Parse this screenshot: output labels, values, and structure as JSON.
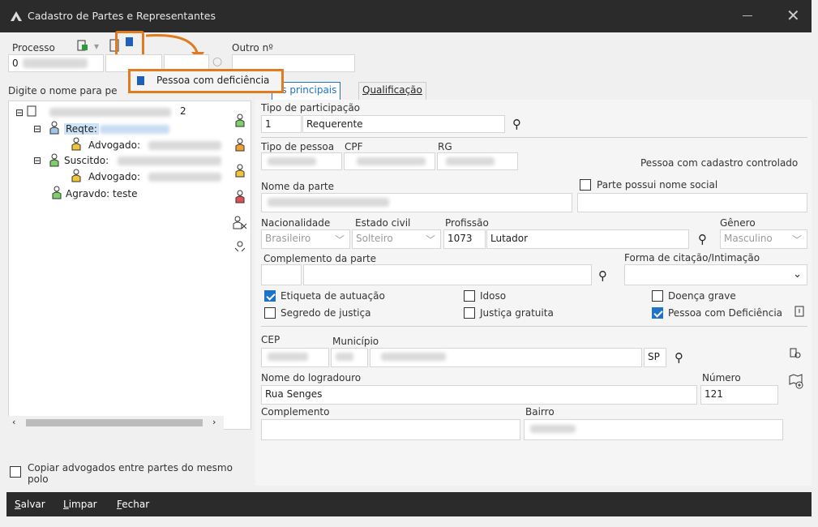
{
  "window": {
    "title": "Cadastro de Partes e Representantes"
  },
  "header": {
    "processo_label": "Processo",
    "processo_value": "0",
    "outro_label": "Outro nº"
  },
  "popup": {
    "item_label": "Pessoa com deficiência"
  },
  "search": {
    "placeholder": "Digite o nome para pe"
  },
  "tabs": [
    {
      "label": "os principais"
    },
    {
      "label": "Qualificação"
    }
  ],
  "tree": {
    "root_suffix": "2",
    "items": [
      {
        "label": "Reqte:"
      },
      {
        "label": "Advogado:"
      },
      {
        "label": "Suscitdo:"
      },
      {
        "label": "Advogado:"
      },
      {
        "label": "Agravdo: teste"
      }
    ]
  },
  "copy_lawyers": {
    "label": "Copiar advogados entre partes do mesmo polo"
  },
  "form": {
    "tipo_participacao_label": "Tipo de participação",
    "tipo_participacao_code": "1",
    "tipo_participacao_value": "Requerente",
    "tipo_pessoa_label": "Tipo de pessoa",
    "cpf_label": "CPF",
    "rg_label": "RG",
    "cadastro_controlado": "Pessoa com cadastro controlado",
    "nome_parte_label": "Nome da parte",
    "nome_social_label": "Parte possui nome social",
    "nacionalidade_label": "Nacionalidade",
    "nacionalidade_value": "Brasileiro",
    "estado_civil_label": "Estado civil",
    "estado_civil_value": "Solteiro",
    "profissao_label": "Profissão",
    "profissao_code": "1073",
    "profissao_value": "Lutador",
    "genero_label": "Gênero",
    "genero_value": "Masculino",
    "complemento_parte_label": "Complemento da parte",
    "forma_citacao_label": "Forma de citação/Intimação",
    "checks": {
      "etiqueta": {
        "label": "Etiqueta de autuação",
        "checked": true
      },
      "idoso": {
        "label": "Idoso",
        "checked": false
      },
      "doenca": {
        "label": "Doença grave",
        "checked": false
      },
      "segredo": {
        "label": "Segredo de justiça",
        "checked": false
      },
      "justica_gratuita": {
        "label": "Justiça gratuita",
        "checked": false
      },
      "deficiencia": {
        "label": "Pessoa com Deficiência",
        "checked": true
      }
    },
    "cep_label": "CEP",
    "municipio_label": "Município",
    "uf_value": "SP",
    "logradouro_label": "Nome do logradouro",
    "logradouro_value": "Rua Senges",
    "numero_label": "Número",
    "numero_value": "121",
    "complemento_label": "Complemento",
    "bairro_label": "Bairro"
  },
  "buttons": {
    "salvar": "alvar",
    "salvar_u": "S",
    "limpar": "impar",
    "limpar_u": "L",
    "fechar": "echar",
    "fechar_u": "F"
  },
  "colors": {
    "accent": "#1e73c8",
    "highlight": "#e07b1f",
    "titlebar": "#2b2b2b"
  }
}
